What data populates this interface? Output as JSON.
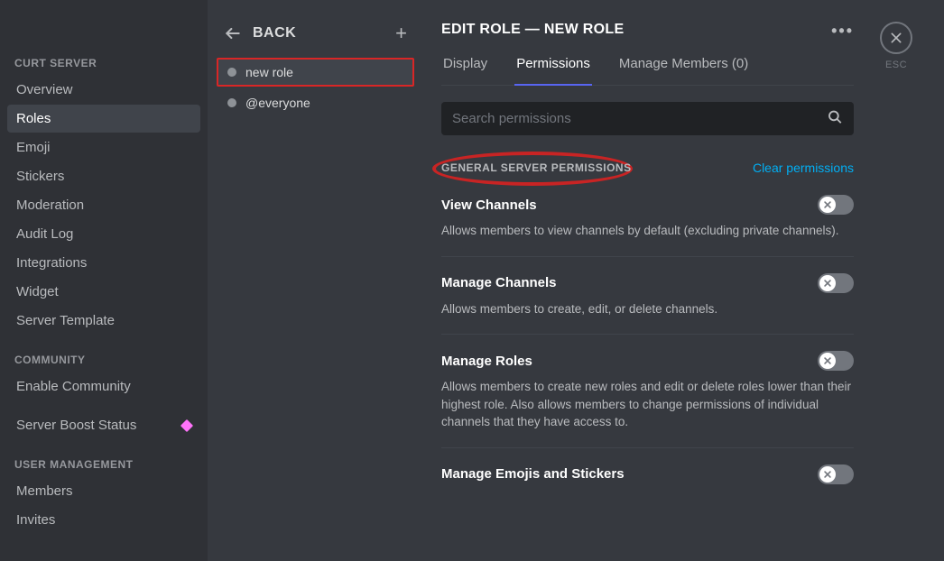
{
  "sidebar": {
    "section1_header": "CURT SERVER",
    "section1_items": [
      {
        "label": "Overview",
        "active": false
      },
      {
        "label": "Roles",
        "active": true
      },
      {
        "label": "Emoji",
        "active": false
      },
      {
        "label": "Stickers",
        "active": false
      },
      {
        "label": "Moderation",
        "active": false
      },
      {
        "label": "Audit Log",
        "active": false
      },
      {
        "label": "Integrations",
        "active": false
      },
      {
        "label": "Widget",
        "active": false
      },
      {
        "label": "Server Template",
        "active": false
      }
    ],
    "section2_header": "COMMUNITY",
    "section2_items": [
      {
        "label": "Enable Community",
        "active": false
      },
      {
        "label": "Server Boost Status",
        "active": false,
        "boost": true
      }
    ],
    "section3_header": "USER MANAGEMENT",
    "section3_items": [
      {
        "label": "Members",
        "active": false
      },
      {
        "label": "Invites",
        "active": false
      }
    ]
  },
  "roleColumn": {
    "back_label": "BACK",
    "roles": [
      {
        "name": "new role",
        "selected": true
      },
      {
        "name": "@everyone",
        "selected": false
      }
    ]
  },
  "main": {
    "title": "EDIT ROLE — NEW ROLE",
    "tabs": [
      {
        "label": "Display",
        "active": false
      },
      {
        "label": "Permissions",
        "active": true
      },
      {
        "label": "Manage Members (0)",
        "active": false
      }
    ],
    "search_placeholder": "Search permissions",
    "section_label": "GENERAL SERVER PERMISSIONS",
    "clear_label": "Clear permissions",
    "permissions": [
      {
        "name": "View Channels",
        "desc": "Allows members to view channels by default (excluding private channels).",
        "on": false
      },
      {
        "name": "Manage Channels",
        "desc": "Allows members to create, edit, or delete channels.",
        "on": false
      },
      {
        "name": "Manage Roles",
        "desc": "Allows members to create new roles and edit or delete roles lower than their highest role. Also allows members to change permissions of individual channels that they have access to.",
        "on": false
      },
      {
        "name": "Manage Emojis and Stickers",
        "desc": "",
        "on": false
      }
    ],
    "close_label": "ESC"
  }
}
